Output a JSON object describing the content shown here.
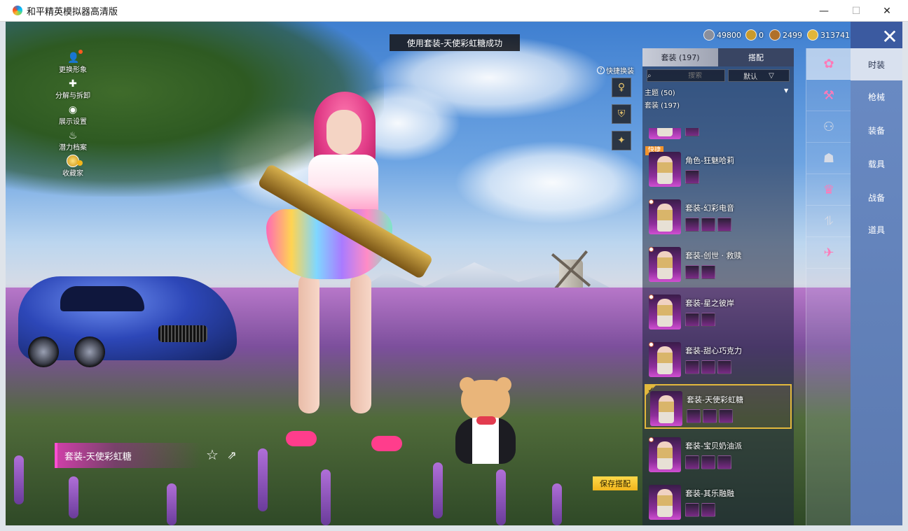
{
  "window": {
    "title": "和平精英模拟器高清版",
    "min_glyph": "—",
    "max_glyph": "☐",
    "close_glyph": "✕"
  },
  "toast": "使用套装-天使彩虹糖成功",
  "currencies": [
    {
      "value": "49800",
      "icon": "silver-coin-icon",
      "color": "#8a8f9c"
    },
    {
      "value": "0",
      "icon": "gold-medal-icon",
      "color": "#c99a2c"
    },
    {
      "value": "2499",
      "icon": "bronze-coin-icon",
      "color": "#b0702a"
    },
    {
      "value": "313741",
      "icon": "coupon-icon",
      "color": "#e1b63b"
    }
  ],
  "close_glyph": "✕",
  "left_menu": [
    {
      "label": "更换形象",
      "icon": "person-icon",
      "glyph": "👤"
    },
    {
      "label": "分解与拆卸",
      "icon": "puzzle-icon",
      "glyph": "✚"
    },
    {
      "label": "展示设置",
      "icon": "eye-icon",
      "glyph": "◉"
    },
    {
      "label": "潜力档案",
      "icon": "flame-icon",
      "glyph": "♨"
    },
    {
      "label": "收藏家",
      "icon": "collector-coin-icon",
      "glyph": ""
    }
  ],
  "quick_switch": {
    "label": "快捷换装",
    "help": "?",
    "slots": [
      {
        "icon": "figure-icon",
        "glyph": "♀"
      },
      {
        "icon": "shield-emblem-icon",
        "glyph": "⛨"
      },
      {
        "icon": "winged-emblem-icon",
        "glyph": "✦"
      }
    ]
  },
  "panel": {
    "tabs": [
      {
        "label": "套装 (197)",
        "active": true
      },
      {
        "label": "搭配",
        "active": false
      }
    ],
    "search_placeholder": "搜索",
    "sort_value": "默认",
    "sort_arrow": "▽",
    "filter_theme": "主题 (50)",
    "filter_set": "套装 (197)",
    "filter_arrow": "▼",
    "items": [
      {
        "name": "",
        "parts": 1,
        "quick": "",
        "selected": false
      },
      {
        "name": "角色-狂魅哈莉",
        "parts": 1,
        "quick": "快捷",
        "selected": false
      },
      {
        "name": "套装-幻彩电音",
        "parts": 3,
        "quick": "",
        "selected": false
      },
      {
        "name": "套装-创世 · 救赎",
        "parts": 2,
        "quick": "",
        "selected": false
      },
      {
        "name": "套装-星之彼岸",
        "parts": 2,
        "quick": "",
        "selected": false
      },
      {
        "name": "套装-甜心巧克力",
        "parts": 3,
        "quick": "",
        "selected": false
      },
      {
        "name": "套装-天使彩虹糖",
        "parts": 3,
        "quick": "",
        "selected": true
      },
      {
        "name": "套装-宝贝奶油派",
        "parts": 3,
        "quick": "",
        "selected": false
      },
      {
        "name": "套装-其乐融融",
        "parts": 2,
        "quick": "",
        "selected": false
      }
    ],
    "checkmark": "✓"
  },
  "save_button": "保存搭配",
  "categories": [
    {
      "label": "时装",
      "icon": "outfit-icon",
      "glyph": "✿",
      "active": true
    },
    {
      "label": "枪械",
      "icon": "gun-icon",
      "glyph": "⚒",
      "active": false
    },
    {
      "label": "装备",
      "icon": "goggles-icon",
      "glyph": "⚇",
      "active": false
    },
    {
      "label": "载具",
      "icon": "helmet-icon",
      "glyph": "☗",
      "active": false
    },
    {
      "label": "战备",
      "icon": "dress-icon",
      "glyph": "♛",
      "active": false
    },
    {
      "label": "道具",
      "icon": "pants-icon",
      "glyph": "⥮",
      "active": false
    },
    {
      "label": "",
      "icon": "parachute-icon",
      "glyph": "✈",
      "active": false
    }
  ],
  "nameplate": "套装-天使彩虹糖",
  "favorite_glyph": "☆",
  "share_glyph": "⇗",
  "accent_colors": {
    "toast_bg": "#19191c",
    "save_yellow": "#f1b51c",
    "select_gold": "#e2b83d",
    "quick_orange": "#f3932b",
    "nameplate_pink": "#ff4fd2"
  }
}
